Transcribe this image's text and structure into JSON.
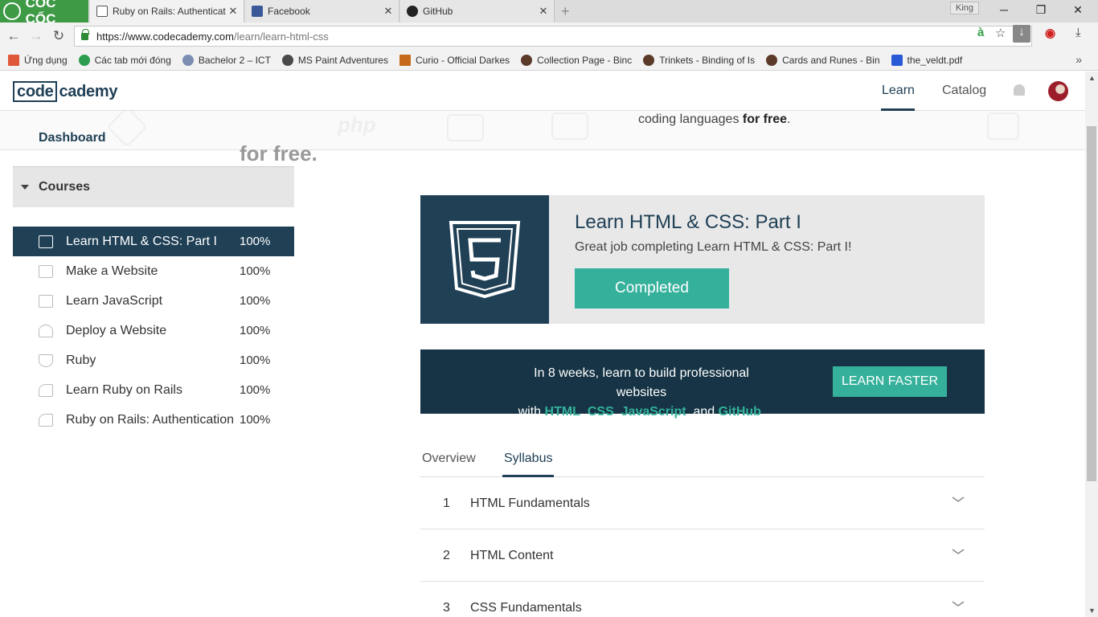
{
  "browser": {
    "logo_text": "CỐC CỐC",
    "tabs": [
      {
        "title": "Ruby on Rails: Authenticati",
        "active": true
      },
      {
        "title": "Facebook",
        "active": false
      },
      {
        "title": "GitHub",
        "active": false
      }
    ],
    "user_name": "King",
    "url_host": "https://www.codecademy.com",
    "url_path": "/learn/learn-html-css",
    "bookmarks": [
      {
        "label": "Ứng dụng",
        "color": "#e0583a"
      },
      {
        "label": "Các tab mới đóng",
        "color": "#2e9c4f"
      },
      {
        "label": "Bachelor 2 – ICT",
        "color": "#7c8fb3"
      },
      {
        "label": "MS Paint Adventures",
        "color": "#4a4a4a"
      },
      {
        "label": "Curio - Official Darkes",
        "color": "#c46a1a"
      },
      {
        "label": "Collection Page - Binc",
        "color": "#5b3a2a"
      },
      {
        "label": "Trinkets - Binding of Is",
        "color": "#5b3a2a"
      },
      {
        "label": "Cards and Runes - Bin",
        "color": "#5b3a2a"
      },
      {
        "label": "the_veldt.pdf",
        "color": "#2a5bd7"
      }
    ]
  },
  "header": {
    "brand_box": "code",
    "brand_rest": "cademy",
    "nav": [
      {
        "label": "Learn",
        "active": true
      },
      {
        "label": "Catalog",
        "active": false
      }
    ]
  },
  "hero": {
    "left_text": "for free.",
    "right_text_plain": "coding languages ",
    "right_text_bold": "for free",
    "right_text_end": "."
  },
  "sidebar": {
    "dashboard_label": "Dashboard",
    "courses_label": "Courses",
    "courses": [
      {
        "name": "Learn HTML & CSS: Part I",
        "progress": "100%",
        "icon": "html5-icon",
        "active": true
      },
      {
        "name": "Make a Website",
        "progress": "100%",
        "icon": "website-icon",
        "active": false
      },
      {
        "name": "Learn JavaScript",
        "progress": "100%",
        "icon": "js-icon",
        "active": false
      },
      {
        "name": "Deploy a Website",
        "progress": "100%",
        "icon": "deploy-icon",
        "active": false
      },
      {
        "name": "Ruby",
        "progress": "100%",
        "icon": "ruby-icon",
        "active": false
      },
      {
        "name": "Learn Ruby on Rails",
        "progress": "100%",
        "icon": "rails-icon",
        "active": false
      },
      {
        "name": "Ruby on Rails: Authentication",
        "progress": "100%",
        "icon": "rails-icon",
        "active": false
      }
    ]
  },
  "course_card": {
    "title": "Learn HTML & CSS: Part I",
    "subtitle": "Great job completing Learn HTML & CSS: Part I!",
    "button_label": "Completed"
  },
  "promo": {
    "line1": "In 8 weeks, learn to build professional websites",
    "with": "with ",
    "html": "HTML",
    "comma1": ", ",
    "css": "CSS",
    "comma2": ", ",
    "js": "JavaScript",
    "and": ", and ",
    "github": "GitHub",
    "period": ".",
    "button_label": "LEARN FASTER"
  },
  "content_tabs": [
    {
      "label": "Overview",
      "active": false
    },
    {
      "label": "Syllabus",
      "active": true
    }
  ],
  "syllabus": [
    {
      "num": "1",
      "name": "HTML Fundamentals"
    },
    {
      "num": "2",
      "name": "HTML Content"
    },
    {
      "num": "3",
      "name": "CSS Fundamentals"
    }
  ],
  "colors": {
    "navy": "#204056",
    "teal": "#35b19b",
    "promo_bg": "#163445"
  }
}
